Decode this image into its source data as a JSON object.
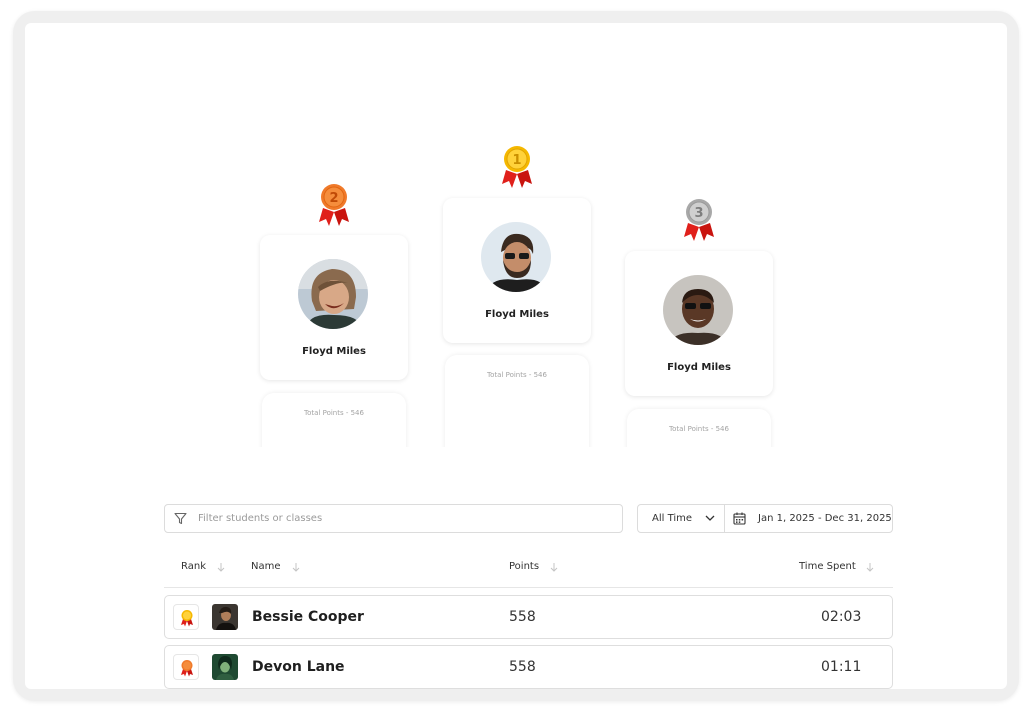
{
  "podium": [
    {
      "rank": 2,
      "medal_label": "2",
      "name": "Floyd Miles",
      "points_text": "Total Points - 546",
      "medal_color": "#f07a2a",
      "avatar": "avatar-laughing-person"
    },
    {
      "rank": 1,
      "medal_label": "1",
      "name": "Floyd Miles",
      "points_text": "Total Points - 546",
      "medal_color": "#f5b800",
      "avatar": "avatar-bearded-man-sunglasses"
    },
    {
      "rank": 3,
      "medal_label": "3",
      "name": "Floyd Miles",
      "points_text": "Total Points - 546",
      "medal_color": "#b5b5b5",
      "avatar": "avatar-man-sunglasses"
    }
  ],
  "filter": {
    "search_placeholder": "Filter students or classes",
    "period": "All Time",
    "date_range": "Jan 1, 2025 - Dec 31, 2025"
  },
  "table": {
    "headers": {
      "rank": "Rank",
      "name": "Name",
      "points": "Points",
      "time": "Time Spent"
    },
    "rows": [
      {
        "name": "Bessie Cooper",
        "points": "558",
        "time": "02:03",
        "medal": "gold-medal-icon"
      },
      {
        "name": "Devon Lane",
        "points": "558",
        "time": "01:11",
        "medal": "bronze-medal-icon"
      },
      {
        "name": "",
        "points": "",
        "time": "",
        "medal": "silver-medal-icon"
      }
    ]
  },
  "colors": {
    "gold": "#f5b800",
    "bronze": "#f07a2a",
    "silver": "#b5b5b5",
    "ribbon": "#e0201b"
  }
}
